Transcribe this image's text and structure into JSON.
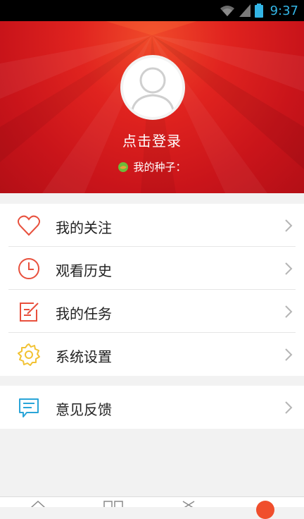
{
  "status_bar": {
    "time": "9:37"
  },
  "profile": {
    "login_prompt": "点击登录",
    "seed_label": "我的种子："
  },
  "menu": {
    "items": [
      {
        "label": "我的关注",
        "icon": "heart-icon"
      },
      {
        "label": "观看历史",
        "icon": "clock-icon"
      },
      {
        "label": "我的任务",
        "icon": "task-edit-icon"
      },
      {
        "label": "系统设置",
        "icon": "gear-icon"
      }
    ],
    "feedback": {
      "label": "意见反馈",
      "icon": "chat-bubble-icon"
    }
  },
  "colors": {
    "header_red": "#e0231f",
    "icon_red": "#e8503d",
    "icon_yellow": "#f2c233",
    "icon_blue": "#2aa5d8",
    "status_blue": "#33b5e5"
  }
}
